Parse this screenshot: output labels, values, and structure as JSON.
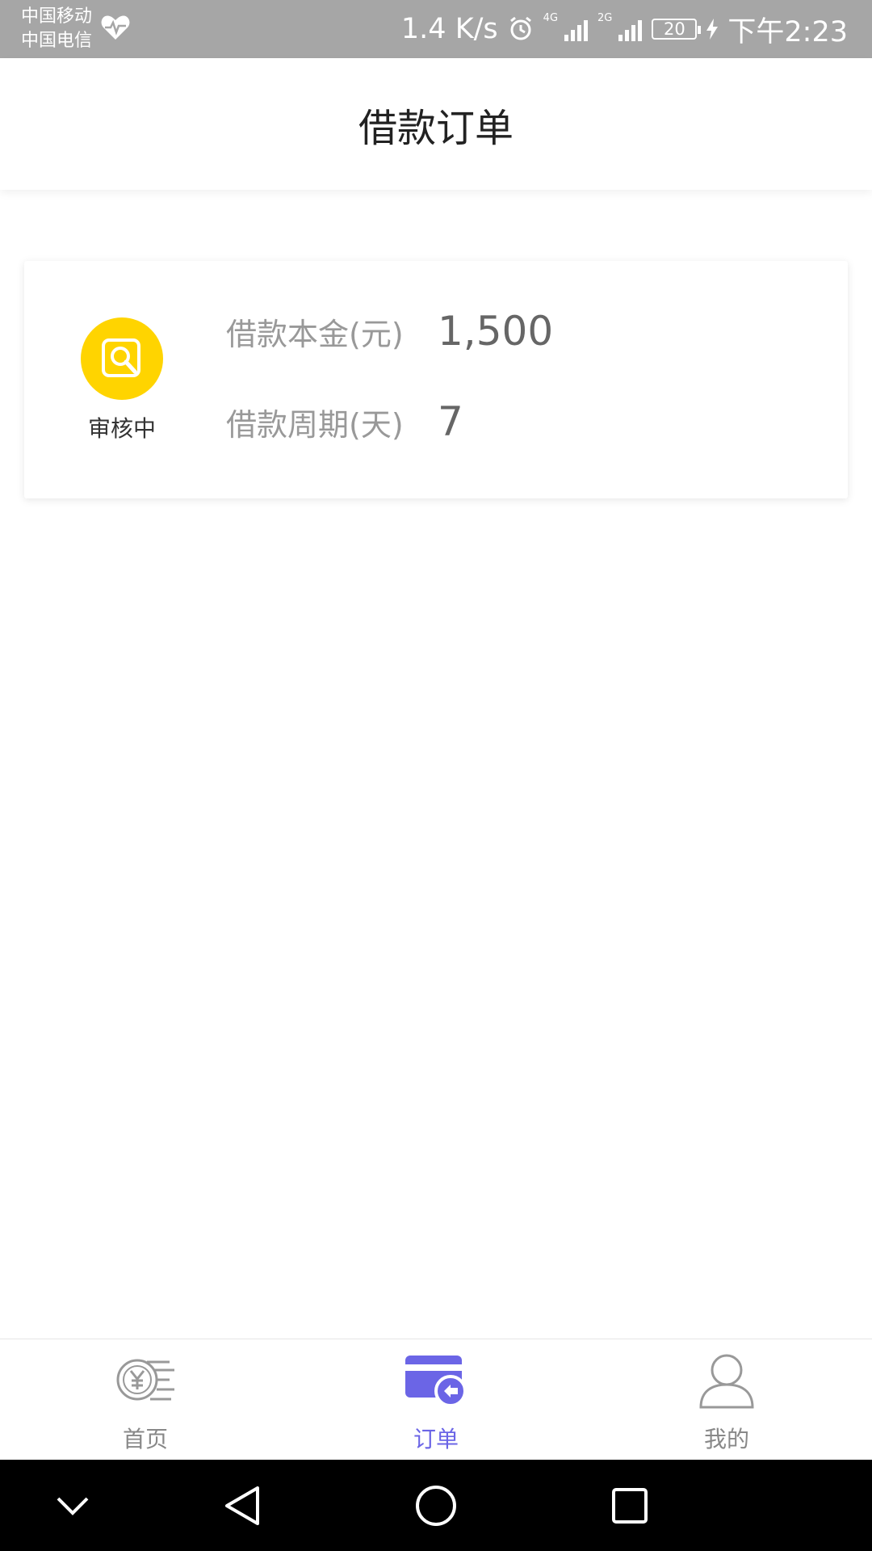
{
  "status_bar": {
    "carrier_1": "中国移动",
    "carrier_2": "中国电信",
    "speed": "1.4 K/s",
    "net_1": "4G",
    "net_2": "2G",
    "battery": "20",
    "time": "下午2:23",
    "icons": [
      "heart-icon",
      "alarm-icon",
      "signal-icon",
      "battery-icon",
      "charging-icon"
    ]
  },
  "header": {
    "title": "借款订单"
  },
  "order": {
    "status": "审核中",
    "status_icon": "search-document-icon",
    "status_color": "#FFD400",
    "principal_label": "借款本金(元)",
    "principal_value": "1,500",
    "period_label": "借款周期(天)",
    "period_value": "7"
  },
  "bottom_nav": {
    "active_color": "#6B65E6",
    "items": [
      {
        "label": "首页",
        "icon": "yen-coins-icon",
        "active": false
      },
      {
        "label": "订单",
        "icon": "card-back-icon",
        "active": true
      },
      {
        "label": "我的",
        "icon": "user-icon",
        "active": false
      }
    ]
  },
  "system_nav": {
    "icons": [
      "chevron-down-icon",
      "back-icon",
      "home-icon",
      "recents-icon"
    ]
  }
}
